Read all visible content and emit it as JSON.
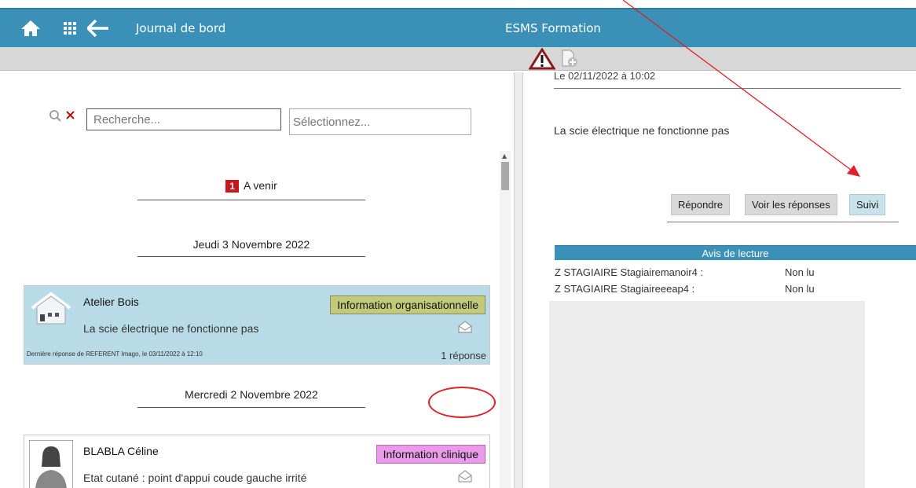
{
  "header": {
    "page_title": "Journal de bord",
    "app_title": "ESMS Formation",
    "icons": [
      "home-icon",
      "grid-icon",
      "back-arrow-icon"
    ]
  },
  "toolbar": {
    "icons": [
      "warning-icon",
      "add-document-icon"
    ]
  },
  "search": {
    "placeholder": "Recherche...",
    "select_placeholder": "Sélectionnez..."
  },
  "sections": {
    "upcoming_count": "1",
    "upcoming_label": "A venir",
    "day1": "Jeudi 3 Novembre 2022",
    "day2": "Mercredi 2 Novembre 2022"
  },
  "entries": [
    {
      "author": "Atelier Bois",
      "message": "La scie électrique ne fonctionne pas",
      "tag": "Information organisationnelle",
      "last_reply": "Dernière réponse de REFERENT Imago, le 03/11/2022 à 12:10",
      "replies": "1 réponse"
    },
    {
      "author": "BLABLA Céline",
      "message": "Etat cutané : point d'appui coude gauche irrité",
      "tag": "Information clinique"
    }
  ],
  "detail": {
    "date": "Le 02/11/2022 à 10:02",
    "message": "La scie électrique ne fonctionne pas",
    "buttons": {
      "reply": "Répondre",
      "view": "Voir les réponses",
      "follow": "Suivi"
    },
    "read_receipts": {
      "title": "Avis de lecture",
      "rows": [
        {
          "who": "Z STAGIAIRE Stagiairemanoir4 :",
          "status": "Non lu"
        },
        {
          "who": "Z STAGIAIRE Stagiaireeeap4 :",
          "status": "Non lu"
        }
      ]
    }
  },
  "colors": {
    "header_blue": "#3b90b8",
    "tag_org": "#c2c97a",
    "tag_clin": "#e99ae9",
    "badge_red": "#c8161d",
    "annotation_red": "#e0202a"
  }
}
